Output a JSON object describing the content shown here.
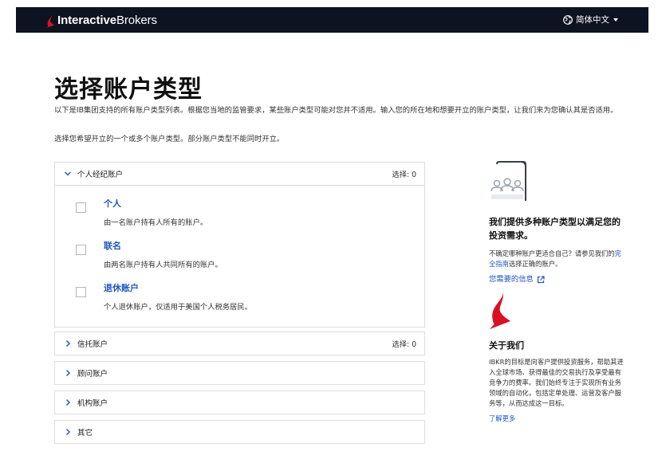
{
  "header": {
    "brand_bold": "Interactive",
    "brand_regular": "Brokers",
    "language": "简体中文",
    "colors": {
      "bar": "#0d1320",
      "logo_red": "#d81222"
    }
  },
  "page": {
    "title": "选择账户类型",
    "intro": "以下是IB集团支持的所有账户类型列表。根据您当地的监管要求，某些账户类型可能对您并不适用。输入您的所在地和想要开立的账户类型，让我们来为您确认其是否适用。",
    "instruction": "选择您希望开立的一个或多个账户类型。部分账户类型不能同时开立。"
  },
  "sections": [
    {
      "label": "个人经纪账户",
      "selected": "选择: 0",
      "expanded": true,
      "options": [
        {
          "title": "个人",
          "desc": "由一名账户持有人所有的账户。"
        },
        {
          "title": "联名",
          "desc": "由两名账户持有人共同所有的账户。"
        },
        {
          "title": "退休账户",
          "desc": "个人退休账户，仅适用于美国个人税务居民。"
        }
      ]
    },
    {
      "label": "信托账户",
      "selected": "选择: 0",
      "expanded": false
    },
    {
      "label": "顾问账户",
      "expanded": false
    },
    {
      "label": "机构账户",
      "expanded": false
    },
    {
      "label": "其它",
      "expanded": false
    }
  ],
  "sidebar": {
    "heading": "我们提供多种账户类型以满足您的投资需求。",
    "text_before": "不确定哪种账户更适合自己？请参见我们的",
    "guide_link": "完全指南",
    "text_after": "选择正确的账户。",
    "info_link": "您需要的信息",
    "about_heading": "关于我们",
    "about_text": "IBKR的目标是向客户提供投资服务，帮助其进入全球市场、获得最佳的交易执行及享受最有竞争力的费率。我们始终专注于实现所有业务领域的自动化，包括定单处理、运营及客户服务等，从而达成这一目标。",
    "learn_more": "了解更多",
    "accent_link": "#1f56c4"
  }
}
